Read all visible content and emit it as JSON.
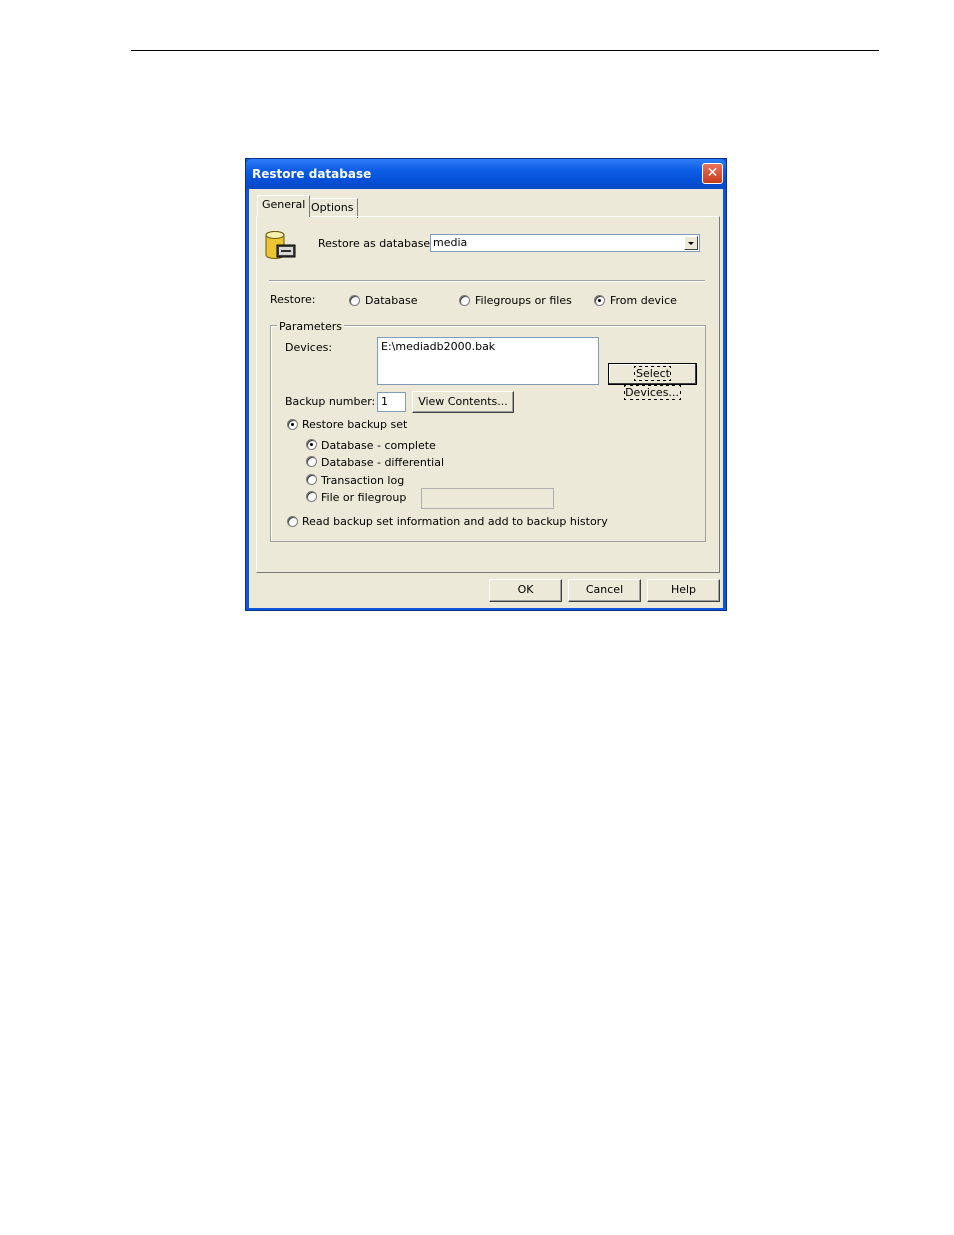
{
  "window": {
    "title": "Restore database",
    "close_glyph": "✕"
  },
  "tabs": [
    {
      "label": "General"
    },
    {
      "label": "Options"
    }
  ],
  "restore_as": {
    "label": "Restore as database:",
    "value": "media"
  },
  "restore": {
    "label": "Restore:",
    "options": [
      {
        "label": "Database",
        "selected": false
      },
      {
        "label": "Filegroups or files",
        "selected": false
      },
      {
        "label": "From device",
        "selected": true
      }
    ]
  },
  "parameters": {
    "title": "Parameters",
    "devices_label": "Devices:",
    "devices_value": "E:\\mediadb2000.bak",
    "select_devices_button": "Select Devices...",
    "backup_number_label": "Backup number:",
    "backup_number_value": "1",
    "view_contents_button": "View Contents...",
    "restore_backup_set": {
      "label": "Restore backup set",
      "selected": true
    },
    "backup_types": [
      {
        "label": "Database - complete",
        "selected": true
      },
      {
        "label": "Database - differential",
        "selected": false
      },
      {
        "label": "Transaction log",
        "selected": false
      },
      {
        "label": "File or filegroup",
        "selected": false
      }
    ],
    "read_backup_info": {
      "label": "Read backup set information and add to backup history",
      "selected": false
    }
  },
  "footer": {
    "ok": "OK",
    "cancel": "Cancel",
    "help": "Help"
  }
}
